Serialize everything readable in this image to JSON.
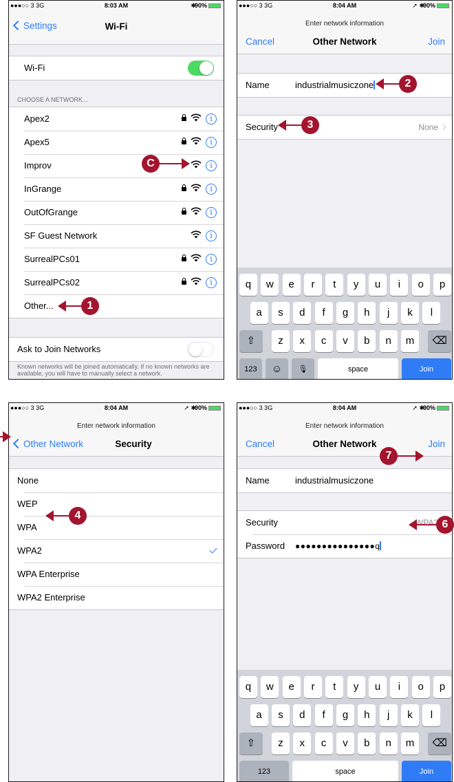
{
  "status_bar": {
    "p1": {
      "carrier": "●●●○○ 3  3G",
      "time": "8:03 AM",
      "bt": "✱",
      "battery": "90%"
    },
    "p2": {
      "carrier": "●●●○○ 3  3G",
      "time": "8:04 AM",
      "bt": "➚ ✱",
      "battery": "90%"
    },
    "p3": {
      "carrier": "●●●○○ 3  3G",
      "time": "8:04 AM",
      "bt": "➚ ✱",
      "battery": "90%"
    },
    "p4": {
      "carrier": "●●●○○ 3  3G",
      "time": "8:04 AM",
      "bt": "➚ ✱",
      "battery": "90%"
    }
  },
  "wifi_screen": {
    "back_label": "Settings",
    "title": "Wi-Fi",
    "wifi_label": "Wi-Fi",
    "wifi_on": true,
    "section_label": "CHOOSE A NETWORK...",
    "networks": [
      {
        "name": "Apex2",
        "locked": true
      },
      {
        "name": "Apex5",
        "locked": true
      },
      {
        "name": "Improv",
        "locked": false
      },
      {
        "name": "InGrange",
        "locked": true
      },
      {
        "name": "OutOfGrange",
        "locked": true
      },
      {
        "name": "SF Guest Network",
        "locked": false
      },
      {
        "name": "SurrealPCs01",
        "locked": true
      },
      {
        "name": "SurrealPCs02",
        "locked": true
      }
    ],
    "other_label": "Other...",
    "ask_label": "Ask to Join Networks",
    "ask_on": false,
    "footnote": "Known networks will be joined automatically. If no known networks are available, you will have to manually select a network."
  },
  "other_network_screen": {
    "prompt": "Enter network information",
    "cancel": "Cancel",
    "title": "Other Network",
    "join": "Join",
    "name_label": "Name",
    "name_value": "industrialmusiczone",
    "security_label": "Security",
    "security_value": "None"
  },
  "security_screen": {
    "prompt": "Enter network information",
    "back_label": "Other Network",
    "title": "Security",
    "options": [
      "None",
      "WEP",
      "WPA",
      "WPA2",
      "WPA Enterprise",
      "WPA2 Enterprise"
    ],
    "selected": "WPA2"
  },
  "password_screen": {
    "prompt": "Enter network information",
    "cancel": "Cancel",
    "title": "Other Network",
    "join": "Join",
    "name_label": "Name",
    "name_value": "industrialmusiczone",
    "security_label": "Security",
    "security_value": "WPA2",
    "password_label": "Password",
    "password_dots": "●●●●●●●●●●●●●●●",
    "password_last": "q"
  },
  "keyboard": {
    "row1": [
      "q",
      "w",
      "e",
      "r",
      "t",
      "y",
      "u",
      "i",
      "o",
      "p"
    ],
    "row2": [
      "a",
      "s",
      "d",
      "f",
      "g",
      "h",
      "j",
      "k",
      "l"
    ],
    "row3": [
      "z",
      "x",
      "c",
      "v",
      "b",
      "n",
      "m"
    ],
    "shift": "⇧",
    "delete": "⌫",
    "numbers": "123",
    "emoji": "☺",
    "mic": "🎙",
    "space": "space",
    "join": "Join"
  },
  "callouts": {
    "c": "C",
    "one": "1",
    "two": "2",
    "three": "3",
    "four": "4",
    "six": "6",
    "seven": "7"
  },
  "colors": {
    "accent": "#2f7cf6",
    "callout": "#a3142e",
    "toggle_on": "#4cd964"
  }
}
